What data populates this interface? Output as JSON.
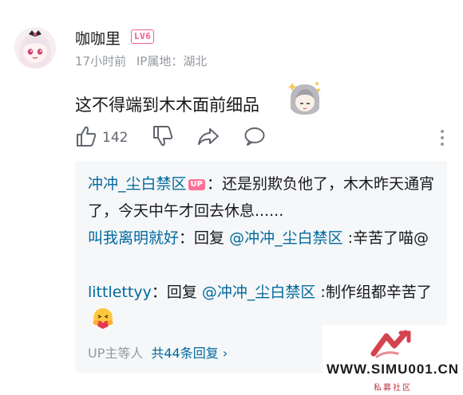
{
  "comment": {
    "username": "咖咖里",
    "level": "LV6",
    "time": "17小时前",
    "ip_location": "IP属地：湖北",
    "text": "这不得端到木木面前细品",
    "likes": "142"
  },
  "replies": [
    {
      "user": "冲冲_尘白禁区",
      "is_up": true,
      "up_label": "UP",
      "text": "：还是别欺负他了，木木昨天通宵了，今天中午才回去休息......"
    },
    {
      "user": "叫我离明就好",
      "prefix": "：回复 ",
      "mention": "@冲冲_尘白禁区",
      "text": " :辛苦了喵@"
    },
    {
      "user": "littlettyy",
      "prefix": "：回复 ",
      "mention": "@冲冲_尘白禁区",
      "text": " :制作组都辛苦了"
    }
  ],
  "replies_footer": {
    "participants": "UP主等人",
    "total": "共44条回复",
    "chevron": "›"
  },
  "watermark": {
    "text": "WWW.SIMU001.CN",
    "sub": "私募社区"
  },
  "colors": {
    "link": "#00699d",
    "level_badge": "#f25d8e",
    "up_badge": "#fb7299",
    "meta": "#9499a0"
  }
}
